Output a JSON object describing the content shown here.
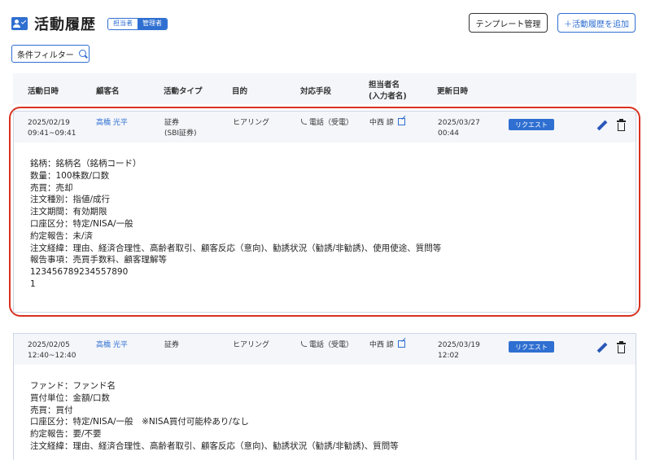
{
  "header": {
    "title": "活動履歴",
    "role_toggle": {
      "option_a": "担当者",
      "option_b": "管理者"
    },
    "template_button": "テンプレート管理",
    "add_button": "＋活動履歴を追加"
  },
  "filter": {
    "label": "条件フィルター"
  },
  "columns": {
    "date": "活動日時",
    "customer": "顧客名",
    "type": "活動タイプ",
    "purpose": "目的",
    "method": "対応手段",
    "staff_line1": "担当者名",
    "staff_line2": "(入力者名)",
    "updated": "更新日時"
  },
  "records": [
    {
      "date": "2025/02/19",
      "time": "09:41~09:41",
      "customer": "高橋 光平",
      "type": "証券",
      "type_sub": "(SBI証券)",
      "purpose": "ヒアリング",
      "method": "電話（受電）",
      "staff": "中西 諒",
      "updated_date": "2025/03/27",
      "updated_time": "00:44",
      "badge": "リクエスト",
      "details": [
        "銘柄：銘柄名（銘柄コード）",
        "数量：100株数/口数",
        "売買：売却",
        "注文種別：指値/成行",
        "注文期間：有効期限",
        "口座区分：特定/NISA/一般",
        "約定報告：未/済",
        "注文経緯：理由、経済合理性、高齢者取引、顧客反応（意向)、勧誘状況（勧誘/非勧誘)、使用使途、質問等",
        "報告事項：売買手数料、顧客理解等",
        "123456789234557890",
        "1"
      ]
    },
    {
      "date": "2025/02/05",
      "time": "12:40~12:40",
      "customer": "高橋 光平",
      "type": "証券",
      "type_sub": "",
      "purpose": "ヒアリング",
      "method": "電話（受電）",
      "staff": "中西 諒",
      "updated_date": "2025/03/19",
      "updated_time": "12:02",
      "badge": "リクエスト",
      "details": [
        "ファンド：ファンド名",
        "買付単位：金額/口数",
        "売買：買付",
        "口座区分：特定/NISA/一般　※NISA買付可能枠あり/なし",
        "約定報告：要/不要",
        "注文経緯：理由、経済合理性、高齢者取引、顧客反応（意向)、勧誘状況（勧誘/非勧誘)、質問等"
      ]
    }
  ]
}
